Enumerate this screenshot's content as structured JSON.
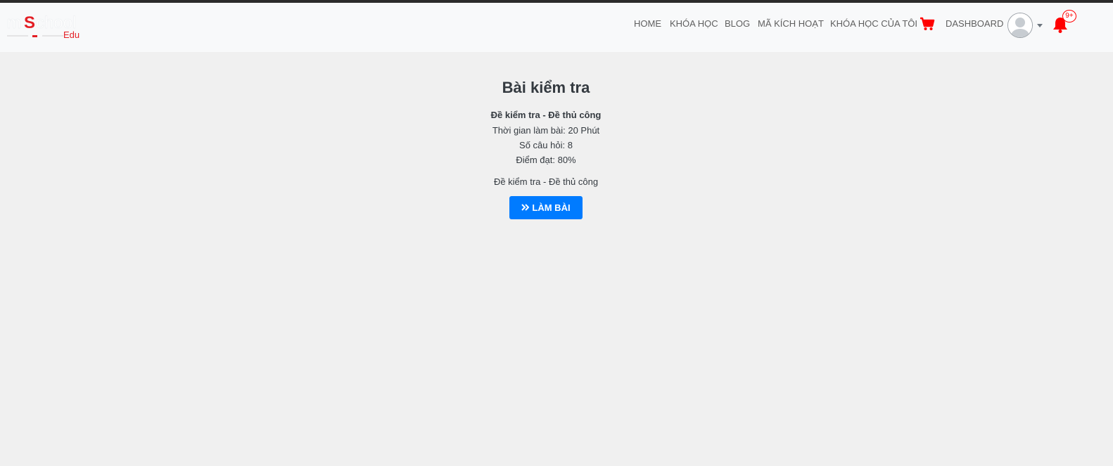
{
  "logo": {
    "text_main": "mSchool",
    "text_sub": "Edu"
  },
  "nav": {
    "home": "HOME",
    "courses": "KHÓA HỌC",
    "blog": "BLOG",
    "activation_code": "MÃ KÍCH HOẠT",
    "my_courses": "KHÓA HỌC CỦA TÔI",
    "dashboard": "DASHBOARD",
    "cart_icon": "cart-icon",
    "bell_icon": "bell-icon",
    "notification_badge": "9+"
  },
  "colors": {
    "accent": "#007bff",
    "alert": "#ff0000",
    "navbar_bg": "#f8f9fa",
    "page_bg": "#f0f0f0"
  },
  "exam": {
    "title": "Bài kiểm tra",
    "name": "Đề kiểm tra - Đề thủ công",
    "time": "Thời gian làm bài: 20 Phút",
    "questions": "Số câu hỏi: 8",
    "pass_score": "Điểm đạt: 80%",
    "description": "Đề kiểm tra - Đề thủ công",
    "start_button": "LÀM BÀI"
  }
}
